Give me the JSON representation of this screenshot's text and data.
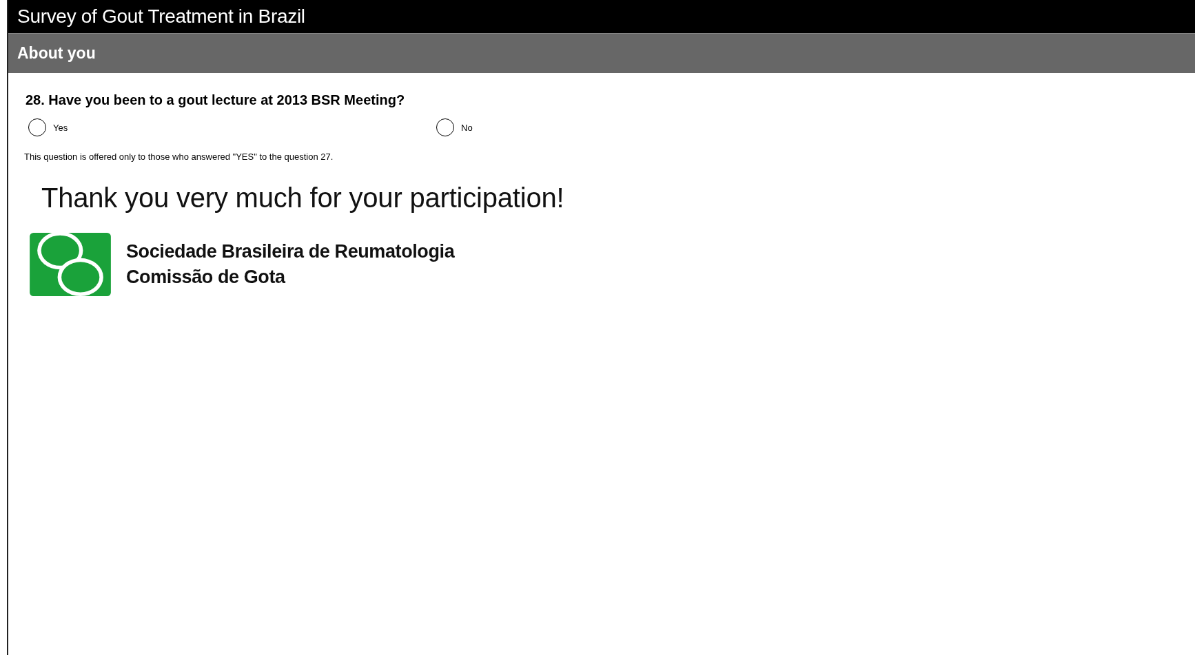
{
  "header": {
    "title": "Survey of Gout Treatment in Brazil"
  },
  "section": {
    "title": "About you"
  },
  "question": {
    "text": "28. Have you been to a gout lecture at 2013 BSR Meeting?",
    "options": [
      {
        "label": "Yes",
        "selected": false
      },
      {
        "label": "No",
        "selected": false
      }
    ],
    "note": "This question is offered only to those who answered \"YES\" to the question 27."
  },
  "closing": {
    "message": "Thank you very much for your participation!",
    "organization": [
      "Sociedade Brasileira de Reumatologia",
      "Comissão de Gota"
    ]
  }
}
